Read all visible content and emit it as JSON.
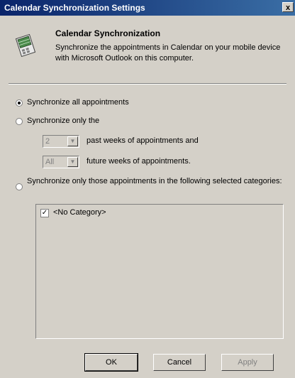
{
  "window": {
    "title": "Calendar Synchronization Settings",
    "close_glyph": "x"
  },
  "header": {
    "icon": "calendar-sync-icon",
    "title": "Calendar Synchronization",
    "description": "Synchronize the appointments in Calendar on your mobile device with Microsoft Outlook on this computer."
  },
  "options": {
    "sync_all_label": "Synchronize all appointments",
    "sync_only_label": "Synchronize only the",
    "past_weeks_value": "2",
    "past_weeks_label": "past weeks of appointments and",
    "future_weeks_value": "All",
    "future_weeks_label": "future weeks of appointments.",
    "sync_categories_label": "Synchronize only those appointments in the following selected categories:",
    "selected": "sync_all"
  },
  "categories": [
    {
      "label": "<No Category>",
      "checked": true
    }
  ],
  "buttons": {
    "ok": "OK",
    "cancel": "Cancel",
    "apply": "Apply"
  }
}
